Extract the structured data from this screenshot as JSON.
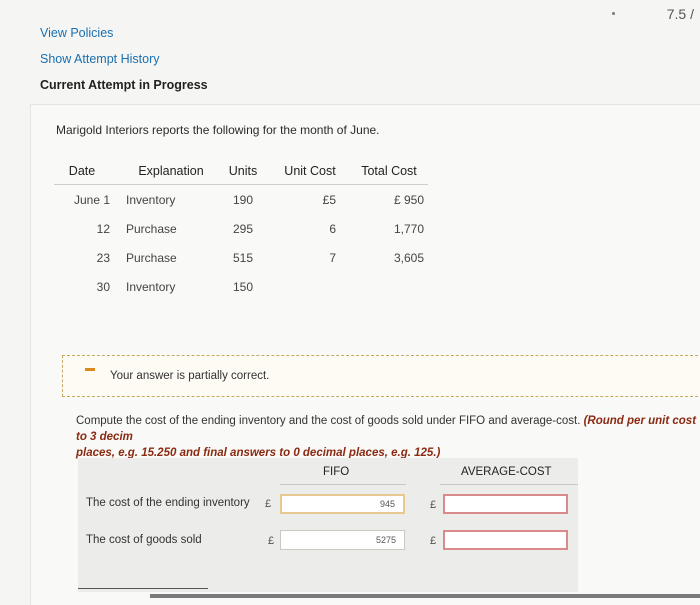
{
  "header": {
    "score": "7.5 /",
    "links": [
      "View Policies",
      "Show Attempt History"
    ],
    "current": "Current Attempt in Progress"
  },
  "problem": {
    "intro": "Marigold Interiors reports the following for the month of June.",
    "columns": [
      "Date",
      "Explanation",
      "Units",
      "Unit Cost",
      "Total Cost"
    ],
    "rows": [
      {
        "date": "June 1",
        "explanation": "Inventory",
        "units": "190",
        "unit_cost": "£5",
        "total_cost": "£ 950"
      },
      {
        "date": "12",
        "explanation": "Purchase",
        "units": "295",
        "unit_cost": "6",
        "total_cost": "1,770"
      },
      {
        "date": "23",
        "explanation": "Purchase",
        "units": "515",
        "unit_cost": "7",
        "total_cost": "3,605"
      },
      {
        "date": "30",
        "explanation": "Inventory",
        "units": "150",
        "unit_cost": "",
        "total_cost": ""
      }
    ]
  },
  "feedback": {
    "text": "Your answer is partially correct."
  },
  "instructions": {
    "main": "Compute the cost of the ending inventory and the cost of goods sold under FIFO and average-cost.",
    "round": "(Round per unit cost to 3 decim",
    "round2": "places, e.g. 15.250 and final answers to 0 decimal places, e.g. 125.)"
  },
  "answers": {
    "col_fifo": "FIFO",
    "col_avg": "AVERAGE-COST",
    "currency": "£",
    "rows": [
      {
        "label": "The cost of the ending inventory",
        "fifo": "945",
        "avg": ""
      },
      {
        "label": "The cost of goods sold",
        "fifo": "5275",
        "avg": ""
      }
    ]
  },
  "colors": {
    "link": "#1a6fb0",
    "partial_border": "#e7c88e",
    "wrong_border": "#d98a8a",
    "emphasis": "#8a2a12"
  }
}
